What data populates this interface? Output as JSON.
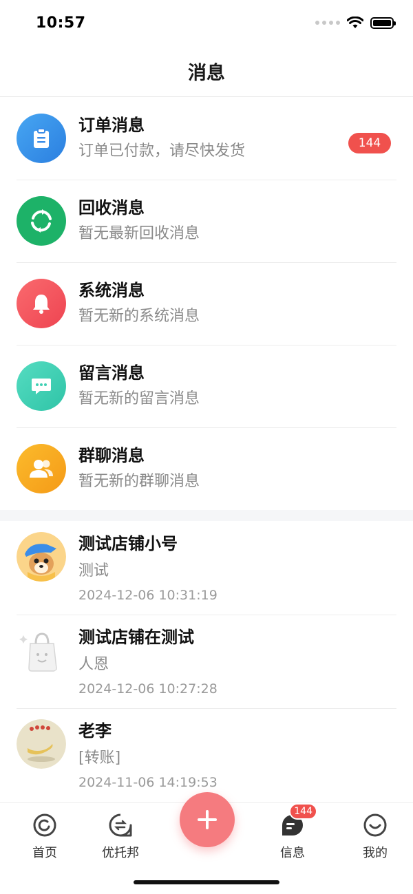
{
  "status": {
    "time": "10:57"
  },
  "header": {
    "title": "消息"
  },
  "system_items": [
    {
      "title": "订单消息",
      "subtitle": "订单已付款，请尽快发货",
      "badge": "144",
      "icon": "clipboard-icon",
      "color": "#3b8de8"
    },
    {
      "title": "回收消息",
      "subtitle": "暂无最新回收消息",
      "icon": "recycle-icon",
      "color": "#1db268"
    },
    {
      "title": "系统消息",
      "subtitle": "暂无新的系统消息",
      "icon": "bell-icon",
      "color": "#f0535a"
    },
    {
      "title": "留言消息",
      "subtitle": "暂无新的留言消息",
      "icon": "chat-bubble-icon",
      "color": "#3fd0b4"
    },
    {
      "title": "群聊消息",
      "subtitle": "暂无新的群聊消息",
      "icon": "group-icon",
      "color": "#f7a821"
    }
  ],
  "chats": [
    {
      "name": "测试店铺小号",
      "message": "测试",
      "time": "2024-12-06 10:31:19"
    },
    {
      "name": "测试店铺在测试",
      "message": "人恩",
      "time": "2024-12-06 10:27:28"
    },
    {
      "name": "老李",
      "message": "[转账]",
      "time": "2024-11-06 14:19:53"
    }
  ],
  "tabbar": {
    "home": "首页",
    "youtuobang": "优托邦",
    "messages": "信息",
    "messages_badge": "144",
    "mine": "我的"
  }
}
